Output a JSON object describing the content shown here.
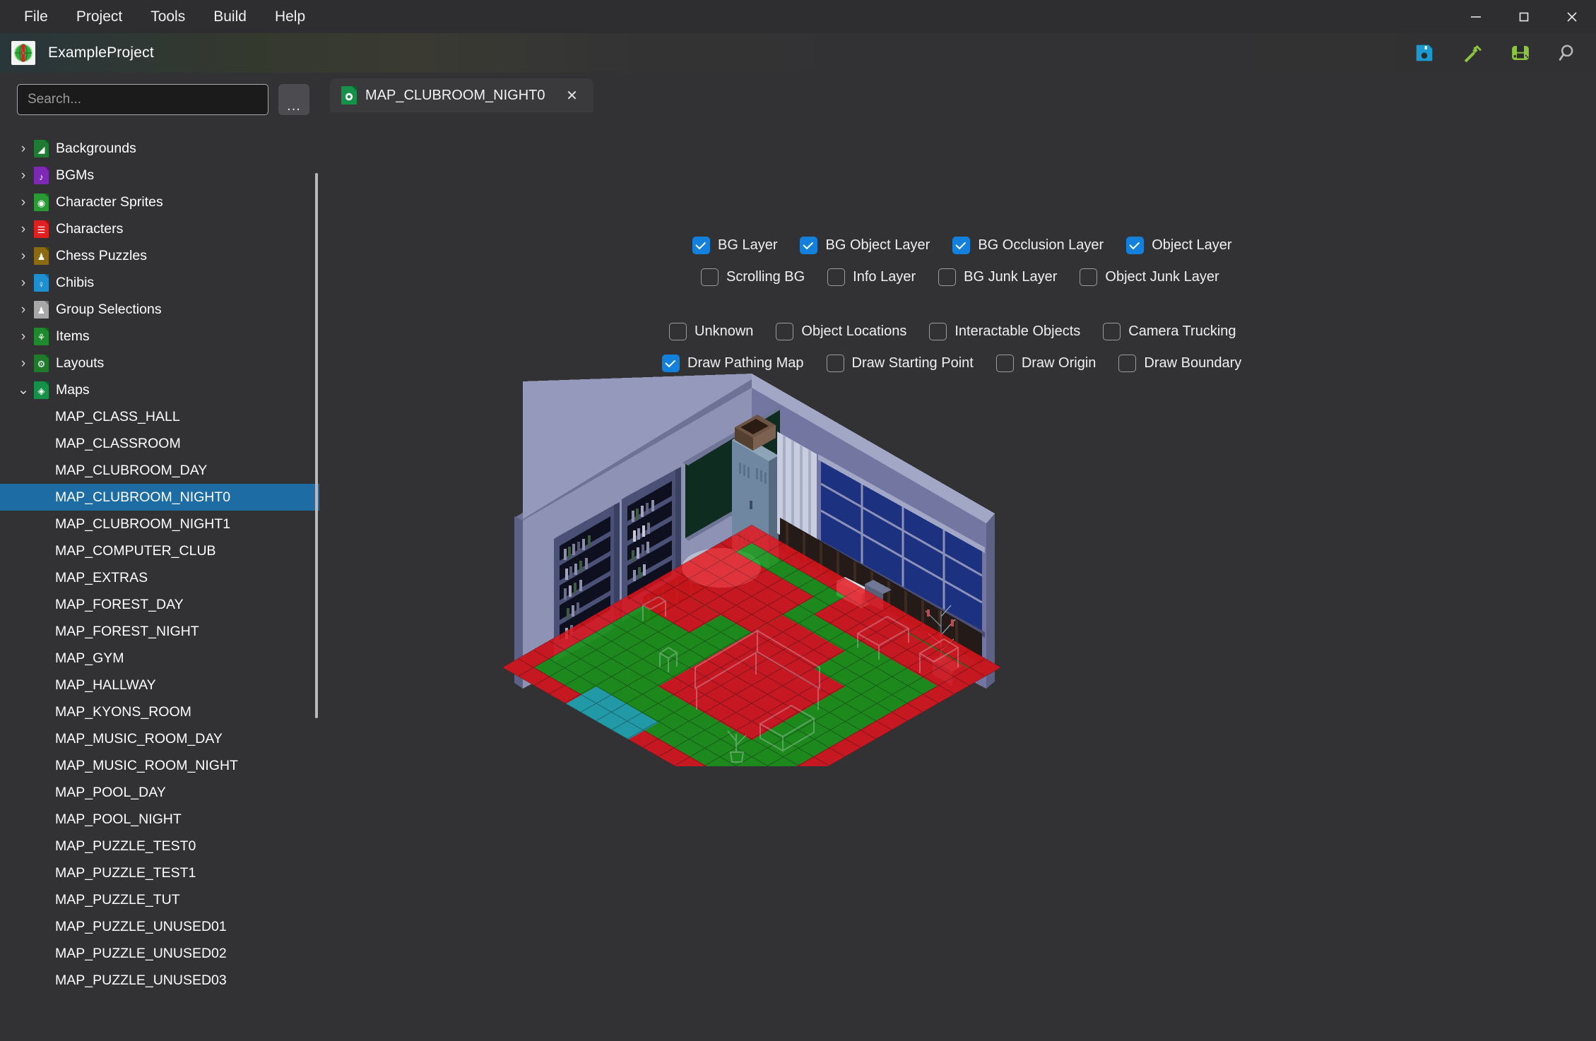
{
  "window": {
    "menu": [
      "File",
      "Project",
      "Tools",
      "Build",
      "Help"
    ],
    "minimize": "—",
    "maximize": "□",
    "close": "✕"
  },
  "project": {
    "title": "ExampleProject",
    "icon": "project-logo-icon",
    "toolbar": [
      {
        "name": "save-icon",
        "label": "Save",
        "color": "#1a9ad0"
      },
      {
        "name": "build-hammer-icon",
        "label": "Build",
        "color": "#8cc63e"
      },
      {
        "name": "run-handheld-icon",
        "label": "Run",
        "color": "#8cc63e"
      },
      {
        "name": "search-icon",
        "label": "Search",
        "color": "#b8b8b8"
      }
    ]
  },
  "sidebar": {
    "search": {
      "placeholder": "Search...",
      "value": ""
    },
    "more_button": "...",
    "groups": [
      {
        "label": "Backgrounds",
        "expanded": false,
        "chevron": "›",
        "icon_color": "#1f7a34",
        "glyph": "◢"
      },
      {
        "label": "BGMs",
        "expanded": false,
        "chevron": "›",
        "icon_color": "#7d29b5",
        "glyph": "♪"
      },
      {
        "label": "Character Sprites",
        "expanded": false,
        "chevron": "›",
        "icon_color": "#2a9a34",
        "glyph": "◉"
      },
      {
        "label": "Characters",
        "expanded": false,
        "chevron": "›",
        "icon_color": "#e02020",
        "glyph": "☰"
      },
      {
        "label": "Chess Puzzles",
        "expanded": false,
        "chevron": "›",
        "icon_color": "#8a6a12",
        "glyph": "♟"
      },
      {
        "label": "Chibis",
        "expanded": false,
        "chevron": "›",
        "icon_color": "#1e8fd0",
        "glyph": "♀"
      },
      {
        "label": "Group Selections",
        "expanded": false,
        "chevron": "›",
        "icon_color": "#a8a8a8",
        "glyph": "♟"
      },
      {
        "label": "Items",
        "expanded": false,
        "chevron": "›",
        "icon_color": "#1f8a2d",
        "glyph": "⚘"
      },
      {
        "label": "Layouts",
        "expanded": false,
        "chevron": "›",
        "icon_color": "#1f7a2c",
        "glyph": "⚙"
      },
      {
        "label": "Maps",
        "expanded": true,
        "chevron": "⌄",
        "icon_color": "#159149",
        "glyph": "◈"
      }
    ],
    "maps": [
      "MAP_CLASS_HALL",
      "MAP_CLASSROOM",
      "MAP_CLUBROOM_DAY",
      "MAP_CLUBROOM_NIGHT0",
      "MAP_CLUBROOM_NIGHT1",
      "MAP_COMPUTER_CLUB",
      "MAP_EXTRAS",
      "MAP_FOREST_DAY",
      "MAP_FOREST_NIGHT",
      "MAP_GYM",
      "MAP_HALLWAY",
      "MAP_KYONS_ROOM",
      "MAP_MUSIC_ROOM_DAY",
      "MAP_MUSIC_ROOM_NIGHT",
      "MAP_POOL_DAY",
      "MAP_POOL_NIGHT",
      "MAP_PUZZLE_TEST0",
      "MAP_PUZZLE_TEST1",
      "MAP_PUZZLE_TUT",
      "MAP_PUZZLE_UNUSED01",
      "MAP_PUZZLE_UNUSED02",
      "MAP_PUZZLE_UNUSED03"
    ],
    "selected_map": "MAP_CLUBROOM_NIGHT0"
  },
  "tabs": [
    {
      "label": "MAP_CLUBROOM_NIGHT0",
      "icon": "map-file-icon",
      "close": "✕",
      "active": true
    }
  ],
  "options": {
    "row1": [
      {
        "label": "BG Layer",
        "checked": true
      },
      {
        "label": "BG Object Layer",
        "checked": true
      },
      {
        "label": "BG Occlusion Layer",
        "checked": true
      },
      {
        "label": "Object Layer",
        "checked": true
      }
    ],
    "row2": [
      {
        "label": "Scrolling BG",
        "checked": false
      },
      {
        "label": "Info Layer",
        "checked": false
      },
      {
        "label": "BG Junk Layer",
        "checked": false
      },
      {
        "label": "Object Junk Layer",
        "checked": false
      }
    ],
    "row3": [
      {
        "label": "Unknown",
        "checked": false
      },
      {
        "label": "Object Locations",
        "checked": false
      },
      {
        "label": "Interactable Objects",
        "checked": false
      },
      {
        "label": "Camera Trucking",
        "checked": false
      }
    ],
    "row4": [
      {
        "label": "Draw Pathing Map",
        "checked": true
      },
      {
        "label": "Draw Starting Point",
        "checked": false
      },
      {
        "label": "Draw Origin",
        "checked": false
      },
      {
        "label": "Draw Boundary",
        "checked": false
      }
    ]
  },
  "viewport": {
    "name": "isometric-map-preview",
    "colors": {
      "walkable": "#1a9e16",
      "blocked": "#e8151c",
      "special": "#1fb3bd",
      "wall": "#8489ad",
      "wall_shadow": "#5d6186",
      "floor": "#2e2b3f",
      "window_glass": "#1c3180",
      "chalkboard": "#12321f",
      "shelf": "#545b85",
      "curtain": "#d6dbe8",
      "background": "#323234"
    }
  }
}
